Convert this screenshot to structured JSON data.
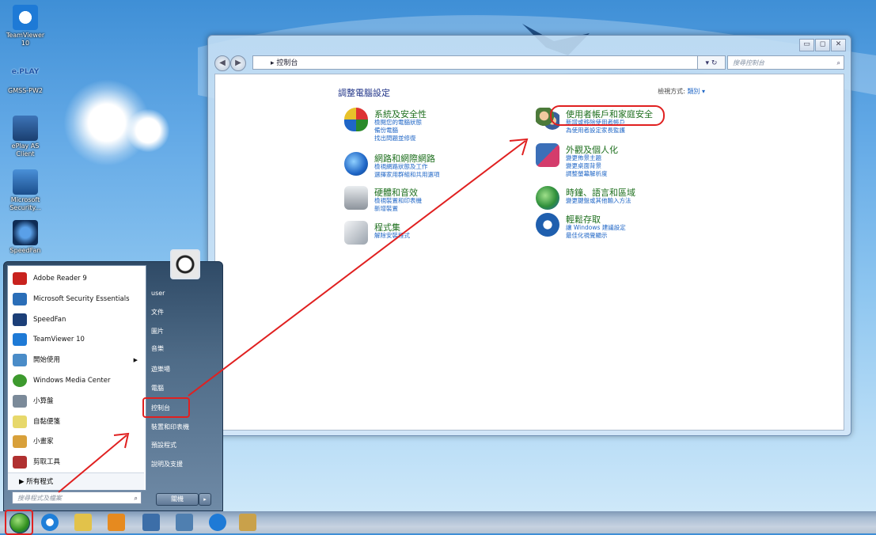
{
  "desktop": {
    "icons": [
      {
        "label": "TeamViewer 10",
        "icon": "teamviewer-icon"
      },
      {
        "label": "e.PLAY",
        "icon": "eplay-logo"
      },
      {
        "label": "GMSS-PW2",
        "icon": "eplay-logo"
      },
      {
        "label": "ePlay AS Client",
        "icon": "computer-icon"
      },
      {
        "label": "Microsoft Security...",
        "icon": "security-icon"
      },
      {
        "label": "SpeedFan",
        "icon": "fan-icon"
      }
    ]
  },
  "window": {
    "address": "控制台",
    "address_prefix": "▸",
    "search_placeholder": "搜尋控制台",
    "refresh_label": "▾ ↻",
    "controls": {
      "minimize": "▭",
      "maximize": "◻",
      "close": "✕"
    },
    "page_title": "調整電腦設定",
    "view_by_label": "檢視方式:",
    "view_by_value": "類別 ▾",
    "categories": [
      {
        "title": "系統及安全性",
        "links": [
          "檢閱您的電腦狀態",
          "備份電腦",
          "找出問題並修復"
        ]
      },
      {
        "title": "網路和網際網路",
        "links": [
          "檢視網路狀態及工作",
          "選擇家用群組和共用選項"
        ]
      },
      {
        "title": "硬體和音效",
        "links": [
          "檢視裝置和印表機",
          "新增裝置"
        ]
      },
      {
        "title": "程式集",
        "links": [
          "解除安裝程式"
        ]
      },
      {
        "title": "使用者帳戶和家庭安全",
        "links": [
          "新增或移除使用者帳戶",
          "為使用者設定家長監護"
        ]
      },
      {
        "title": "外觀及個人化",
        "links": [
          "變更佈景主題",
          "變更桌面背景",
          "調整螢幕解析度"
        ]
      },
      {
        "title": "時鐘、語言和區域",
        "links": [
          "變更鍵盤或其他輸入方法"
        ]
      },
      {
        "title": "輕鬆存取",
        "links": [
          "讓 Windows 建議設定",
          "最佳化視覺顯示"
        ]
      }
    ]
  },
  "start_menu": {
    "programs": [
      {
        "label": "Adobe Reader 9",
        "icon": "adobe-reader-icon",
        "color": "#c8221e"
      },
      {
        "label": "Microsoft Security Essentials",
        "icon": "security-icon",
        "color": "#2a6eb8"
      },
      {
        "label": "SpeedFan",
        "icon": "fan-icon",
        "color": "#1c3f78"
      },
      {
        "label": "TeamViewer 10",
        "icon": "teamviewer-icon",
        "color": "#1e7ad6"
      },
      {
        "label": "開始使用",
        "icon": "getting-started-icon",
        "color": "#4a8cc8",
        "has_arrow": true
      },
      {
        "label": "Windows Media Center",
        "icon": "media-center-icon",
        "color": "#3d9a2e"
      },
      {
        "label": "小算盤",
        "icon": "calculator-icon",
        "color": "#7b8a99"
      },
      {
        "label": "自黏便箋",
        "icon": "sticky-notes-icon",
        "color": "#e7d86b"
      },
      {
        "label": "小畫家",
        "icon": "paint-icon",
        "color": "#d8a03a"
      },
      {
        "label": "剪取工具",
        "icon": "snipping-tool-icon",
        "color": "#b03030"
      }
    ],
    "all_programs": "所有程式",
    "search_placeholder": "搜尋程式及檔案",
    "right_items": [
      "user",
      "文件",
      "圖片",
      "音樂",
      "遊樂場",
      "電腦",
      "控制台",
      "裝置和印表機",
      "預設程式",
      "說明及支援"
    ],
    "shutdown_label": "關機",
    "shutdown_arrow": "▸"
  },
  "taskbar": {
    "items": [
      {
        "icon": "internet-explorer-icon",
        "color": "#1f7fd8"
      },
      {
        "icon": "file-explorer-icon",
        "color": "#e2c24a"
      },
      {
        "icon": "media-player-icon",
        "color": "#e68a1f"
      },
      {
        "icon": "computer-icon",
        "color": "#3c6ea8"
      },
      {
        "icon": "remote-desktop-icon",
        "color": "#4f7fb0"
      },
      {
        "icon": "teamviewer-icon",
        "color": "#1e7ad6"
      },
      {
        "icon": "paint-icon",
        "color": "#c9a14a"
      }
    ]
  },
  "annotations": {
    "highlight_color": "#e02020"
  }
}
